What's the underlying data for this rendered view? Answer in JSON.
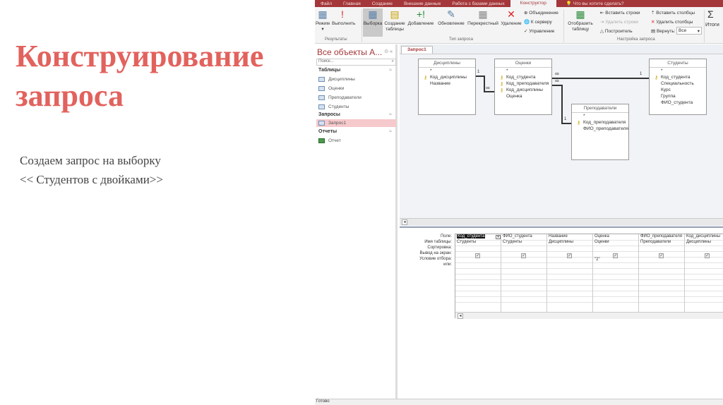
{
  "slide": {
    "title": "Конструирование запроса",
    "line1": "Создаем запрос на выборку",
    "line2": "<< Студентов с двойками>>"
  },
  "app": {
    "tabs": [
      "Файл",
      "Главная",
      "Создание",
      "Внешние данные",
      "Работа с базами данных",
      "Конструктор"
    ],
    "search": "Что вы хотите сделать?",
    "ribbon": {
      "mode": "Режим",
      "run": "Выполнить",
      "results_group": "Результаты",
      "select": "Выборка",
      "make_table": "Создание таблицы",
      "append": "Добавление",
      "update": "Обновление",
      "crosstab": "Перекрестный",
      "delete": "Удаление",
      "union": "Объединение",
      "server": "К серверу",
      "manage": "Управление",
      "type_group": "Тип запроса",
      "show_table": "Отобразить таблицу",
      "insert_rows": "Вставить строки",
      "delete_rows": "Удалить строки",
      "builder": "Построитель",
      "insert_cols": "Вставить столбцы",
      "delete_cols": "Удалить столбцы",
      "return": "Вернуть:",
      "return_value": "Все",
      "setup_group": "Настройка запроса",
      "totals": "Итоги"
    },
    "nav": {
      "header": "Все объекты A...",
      "search_placeholder": "Поиск...",
      "cat_tables": "Таблицы",
      "tables": [
        "Дисциплины",
        "Оценки",
        "Преподаватели",
        "Студенты"
      ],
      "cat_queries": "Запросы",
      "queries": [
        "Запрос1"
      ],
      "cat_reports": "Отчеты",
      "reports": [
        "Отчет"
      ]
    },
    "query_tab": "Запрос1",
    "tables": {
      "disc": {
        "name": "Дисциплины",
        "fields": [
          "*",
          "Код_дисциплины",
          "Название"
        ]
      },
      "grades": {
        "name": "Оценки",
        "fields": [
          "*",
          "Код_студента",
          "Код_преподавателя",
          "Код_дисциплины",
          "Оценка"
        ]
      },
      "teachers": {
        "name": "Преподаватели",
        "fields": [
          "*",
          "Код_преподавателя",
          "ФИО_преподавателя"
        ]
      },
      "students": {
        "name": "Студенты",
        "fields": [
          "*",
          "Код_студента",
          "Специальность",
          "Курс",
          "Группа",
          "ФИО_студента"
        ]
      }
    },
    "rel": {
      "one": "1",
      "many": "∞"
    },
    "grid": {
      "row_labels": [
        "Поле:",
        "Имя таблицы:",
        "Сортировка:",
        "Вывод на экран:",
        "Условие отбора:",
        "или:"
      ],
      "columns": [
        {
          "field": "Код_студента",
          "table": "Студенты",
          "criteria": ""
        },
        {
          "field": "ФИО_студента",
          "table": "Студенты",
          "criteria": ""
        },
        {
          "field": "Название",
          "table": "Дисциплины",
          "criteria": ""
        },
        {
          "field": "Оценка",
          "table": "Оценки",
          "criteria": "\"2\""
        },
        {
          "field": "ФИО_преподавателя",
          "table": "Преподаватели",
          "criteria": ""
        },
        {
          "field": "Код_дисциплины",
          "table": "Дисциплины",
          "criteria": ""
        }
      ]
    },
    "status": "Готово"
  }
}
